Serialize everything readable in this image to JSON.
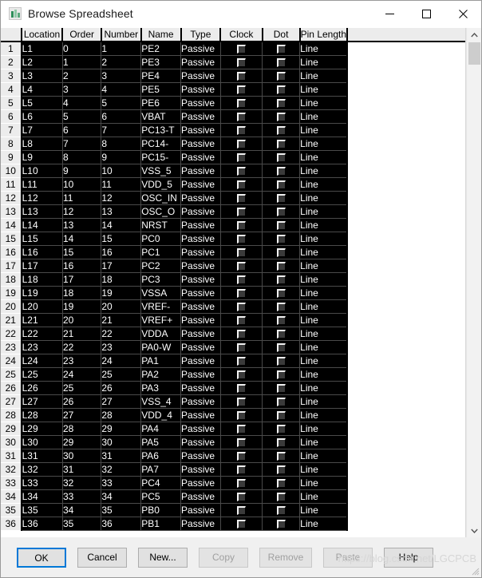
{
  "window": {
    "title": "Browse Spreadsheet",
    "icon": "spreadsheet-icon",
    "minimize_label": "—",
    "maximize_label": "□",
    "close_label": "✕"
  },
  "table": {
    "corner_label": "",
    "columns": [
      "Location",
      "Order",
      "Number",
      "Name",
      "Type",
      "Clock",
      "Dot",
      "Pin Length"
    ],
    "rows": [
      {
        "n": "1",
        "location": "L1",
        "order": "0",
        "number": "1",
        "name": "PE2",
        "type": "Passive",
        "clock": false,
        "dot": false,
        "pin_length": "Line"
      },
      {
        "n": "2",
        "location": "L2",
        "order": "1",
        "number": "2",
        "name": "PE3",
        "type": "Passive",
        "clock": false,
        "dot": false,
        "pin_length": "Line"
      },
      {
        "n": "3",
        "location": "L3",
        "order": "2",
        "number": "3",
        "name": "PE4",
        "type": "Passive",
        "clock": false,
        "dot": false,
        "pin_length": "Line"
      },
      {
        "n": "4",
        "location": "L4",
        "order": "3",
        "number": "4",
        "name": "PE5",
        "type": "Passive",
        "clock": false,
        "dot": false,
        "pin_length": "Line"
      },
      {
        "n": "5",
        "location": "L5",
        "order": "4",
        "number": "5",
        "name": "PE6",
        "type": "Passive",
        "clock": false,
        "dot": false,
        "pin_length": "Line"
      },
      {
        "n": "6",
        "location": "L6",
        "order": "5",
        "number": "6",
        "name": "VBAT",
        "type": "Passive",
        "clock": false,
        "dot": false,
        "pin_length": "Line"
      },
      {
        "n": "7",
        "location": "L7",
        "order": "6",
        "number": "7",
        "name": "PC13-T",
        "type": "Passive",
        "clock": false,
        "dot": false,
        "pin_length": "Line"
      },
      {
        "n": "8",
        "location": "L8",
        "order": "7",
        "number": "8",
        "name": "PC14-",
        "type": "Passive",
        "clock": false,
        "dot": false,
        "pin_length": "Line"
      },
      {
        "n": "9",
        "location": "L9",
        "order": "8",
        "number": "9",
        "name": "PC15-",
        "type": "Passive",
        "clock": false,
        "dot": false,
        "pin_length": "Line"
      },
      {
        "n": "10",
        "location": "L10",
        "order": "9",
        "number": "10",
        "name": "VSS_5",
        "type": "Passive",
        "clock": false,
        "dot": false,
        "pin_length": "Line"
      },
      {
        "n": "11",
        "location": "L11",
        "order": "10",
        "number": "11",
        "name": "VDD_5",
        "type": "Passive",
        "clock": false,
        "dot": false,
        "pin_length": "Line"
      },
      {
        "n": "12",
        "location": "L12",
        "order": "11",
        "number": "12",
        "name": "OSC_IN",
        "type": "Passive",
        "clock": false,
        "dot": false,
        "pin_length": "Line"
      },
      {
        "n": "13",
        "location": "L13",
        "order": "12",
        "number": "13",
        "name": "OSC_O",
        "type": "Passive",
        "clock": false,
        "dot": false,
        "pin_length": "Line"
      },
      {
        "n": "14",
        "location": "L14",
        "order": "13",
        "number": "14",
        "name": "NRST",
        "type": "Passive",
        "clock": false,
        "dot": false,
        "pin_length": "Line"
      },
      {
        "n": "15",
        "location": "L15",
        "order": "14",
        "number": "15",
        "name": "PC0",
        "type": "Passive",
        "clock": false,
        "dot": false,
        "pin_length": "Line"
      },
      {
        "n": "16",
        "location": "L16",
        "order": "15",
        "number": "16",
        "name": "PC1",
        "type": "Passive",
        "clock": false,
        "dot": false,
        "pin_length": "Line"
      },
      {
        "n": "17",
        "location": "L17",
        "order": "16",
        "number": "17",
        "name": "PC2",
        "type": "Passive",
        "clock": false,
        "dot": false,
        "pin_length": "Line"
      },
      {
        "n": "18",
        "location": "L18",
        "order": "17",
        "number": "18",
        "name": "PC3",
        "type": "Passive",
        "clock": false,
        "dot": false,
        "pin_length": "Line"
      },
      {
        "n": "19",
        "location": "L19",
        "order": "18",
        "number": "19",
        "name": "VSSA",
        "type": "Passive",
        "clock": false,
        "dot": false,
        "pin_length": "Line"
      },
      {
        "n": "20",
        "location": "L20",
        "order": "19",
        "number": "20",
        "name": "VREF-",
        "type": "Passive",
        "clock": false,
        "dot": false,
        "pin_length": "Line"
      },
      {
        "n": "21",
        "location": "L21",
        "order": "20",
        "number": "21",
        "name": "VREF+",
        "type": "Passive",
        "clock": false,
        "dot": false,
        "pin_length": "Line"
      },
      {
        "n": "22",
        "location": "L22",
        "order": "21",
        "number": "22",
        "name": "VDDA",
        "type": "Passive",
        "clock": false,
        "dot": false,
        "pin_length": "Line"
      },
      {
        "n": "23",
        "location": "L23",
        "order": "22",
        "number": "23",
        "name": "PA0-W",
        "type": "Passive",
        "clock": false,
        "dot": false,
        "pin_length": "Line"
      },
      {
        "n": "24",
        "location": "L24",
        "order": "23",
        "number": "24",
        "name": "PA1",
        "type": "Passive",
        "clock": false,
        "dot": false,
        "pin_length": "Line"
      },
      {
        "n": "25",
        "location": "L25",
        "order": "24",
        "number": "25",
        "name": "PA2",
        "type": "Passive",
        "clock": false,
        "dot": false,
        "pin_length": "Line"
      },
      {
        "n": "26",
        "location": "L26",
        "order": "25",
        "number": "26",
        "name": "PA3",
        "type": "Passive",
        "clock": false,
        "dot": false,
        "pin_length": "Line"
      },
      {
        "n": "27",
        "location": "L27",
        "order": "26",
        "number": "27",
        "name": "VSS_4",
        "type": "Passive",
        "clock": false,
        "dot": false,
        "pin_length": "Line"
      },
      {
        "n": "28",
        "location": "L28",
        "order": "27",
        "number": "28",
        "name": "VDD_4",
        "type": "Passive",
        "clock": false,
        "dot": false,
        "pin_length": "Line"
      },
      {
        "n": "29",
        "location": "L29",
        "order": "28",
        "number": "29",
        "name": "PA4",
        "type": "Passive",
        "clock": false,
        "dot": false,
        "pin_length": "Line"
      },
      {
        "n": "30",
        "location": "L30",
        "order": "29",
        "number": "30",
        "name": "PA5",
        "type": "Passive",
        "clock": false,
        "dot": false,
        "pin_length": "Line"
      },
      {
        "n": "31",
        "location": "L31",
        "order": "30",
        "number": "31",
        "name": "PA6",
        "type": "Passive",
        "clock": false,
        "dot": false,
        "pin_length": "Line"
      },
      {
        "n": "32",
        "location": "L32",
        "order": "31",
        "number": "32",
        "name": "PA7",
        "type": "Passive",
        "clock": false,
        "dot": false,
        "pin_length": "Line"
      },
      {
        "n": "33",
        "location": "L33",
        "order": "32",
        "number": "33",
        "name": "PC4",
        "type": "Passive",
        "clock": false,
        "dot": false,
        "pin_length": "Line"
      },
      {
        "n": "34",
        "location": "L34",
        "order": "33",
        "number": "34",
        "name": "PC5",
        "type": "Passive",
        "clock": false,
        "dot": false,
        "pin_length": "Line"
      },
      {
        "n": "35",
        "location": "L35",
        "order": "34",
        "number": "35",
        "name": "PB0",
        "type": "Passive",
        "clock": false,
        "dot": false,
        "pin_length": "Line"
      },
      {
        "n": "36",
        "location": "L36",
        "order": "35",
        "number": "36",
        "name": "PB1",
        "type": "Passive",
        "clock": false,
        "dot": false,
        "pin_length": "Line"
      }
    ]
  },
  "scrollbar": {
    "up_arrow": "chevron-up-icon",
    "down_arrow": "chevron-down-icon"
  },
  "buttons": [
    {
      "label": "OK",
      "state": "default"
    },
    {
      "label": "Cancel",
      "state": "normal"
    },
    {
      "label": "New...",
      "state": "normal"
    },
    {
      "label": "Copy",
      "state": "disabled"
    },
    {
      "label": "Remove",
      "state": "disabled"
    },
    {
      "label": "Paste",
      "state": "disabled"
    },
    {
      "label": "Help",
      "state": "normal"
    }
  ],
  "watermark": "https://blog.csdn.net/LGCPCB",
  "colors": {
    "accent": "#0078d7",
    "grid_bg": "#000000",
    "grid_text": "#ffffff",
    "header_bg": "#ececec",
    "dialog_bg": "#f0f0f0"
  }
}
